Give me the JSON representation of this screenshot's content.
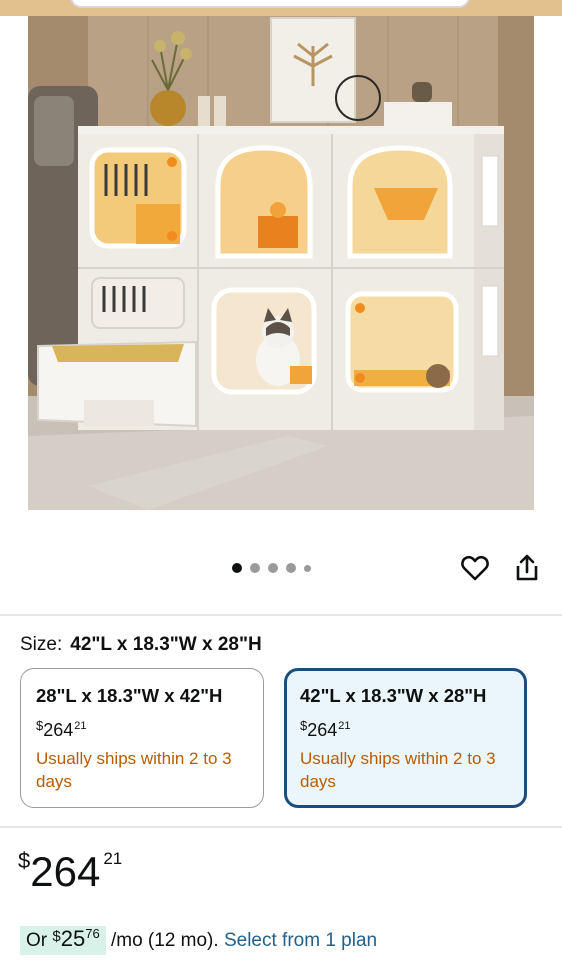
{
  "image": {
    "alt_icon": "cat-cabinet-photo",
    "carousel": {
      "count": 5,
      "active_index": 0
    }
  },
  "actions": {
    "wishlist_icon": "heart-icon",
    "share_icon": "share-icon"
  },
  "size": {
    "label": "Size:",
    "selected": "42\"L x 18.3\"W x 28\"H"
  },
  "options": [
    {
      "title": "28\"L x 18.3\"W x 42\"H",
      "price_currency": "$",
      "price_whole": "264",
      "price_cents": "21",
      "shipping": "Usually ships within 2 to 3 days",
      "selected": false
    },
    {
      "title": "42\"L x 18.3\"W x 28\"H",
      "price_currency": "$",
      "price_whole": "264",
      "price_cents": "21",
      "shipping": "Usually ships within 2 to 3 days",
      "selected": true
    }
  ],
  "price": {
    "currency": "$",
    "whole": "264",
    "cents": "21"
  },
  "installment": {
    "prefix": "Or",
    "currency": "$",
    "amount": "25",
    "cents": "76",
    "term": "/mo (12 mo).",
    "link": "Select from 1 plan"
  },
  "colors": {
    "accent_selected_border": "#1d4e7b",
    "selected_bg": "#eaf6fc",
    "shipping_text": "#b85c00",
    "link": "#23608c",
    "installment_highlight": "#d8f2ea"
  }
}
